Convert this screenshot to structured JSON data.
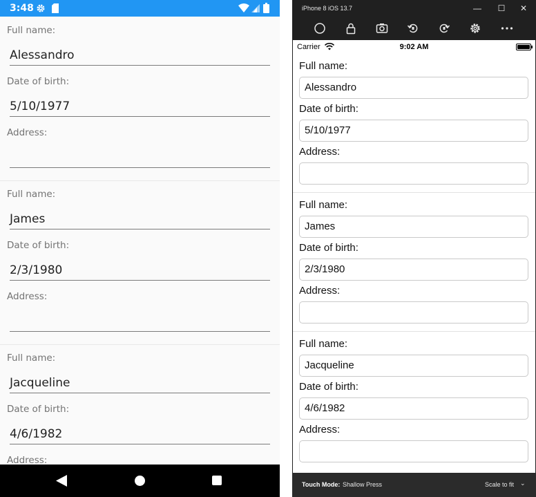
{
  "android": {
    "status_time": "3:48",
    "labels": {
      "name": "Full name:",
      "dob": "Date of birth:",
      "address": "Address:"
    },
    "forms": [
      {
        "name": "Alessandro",
        "dob": "5/10/1977",
        "address": ""
      },
      {
        "name": "James",
        "dob": "2/3/1980",
        "address": ""
      },
      {
        "name": "Jacqueline",
        "dob": "4/6/1982",
        "address": ""
      }
    ]
  },
  "ios": {
    "window_title": "iPhone 8 iOS 13.7",
    "window_buttons": {
      "minimize": "—",
      "maximize": "☐",
      "close": "✕"
    },
    "carrier": "Carrier",
    "time": "9:02 AM",
    "labels": {
      "name": "Full name:",
      "dob": "Date of birth:",
      "address": "Address:"
    },
    "forms": [
      {
        "name": "Alessandro",
        "dob": "5/10/1977",
        "address": ""
      },
      {
        "name": "James",
        "dob": "2/3/1980",
        "address": ""
      },
      {
        "name": "Jacqueline",
        "dob": "4/6/1982",
        "address": ""
      }
    ],
    "bottom": {
      "touch_mode_label": "Touch Mode:",
      "touch_mode_value": "Shallow Press",
      "scale": "Scale to fit",
      "scale_chevron": "⌄"
    }
  },
  "colors": {
    "android_status": "#2196f3",
    "sim_chrome": "#202020"
  }
}
